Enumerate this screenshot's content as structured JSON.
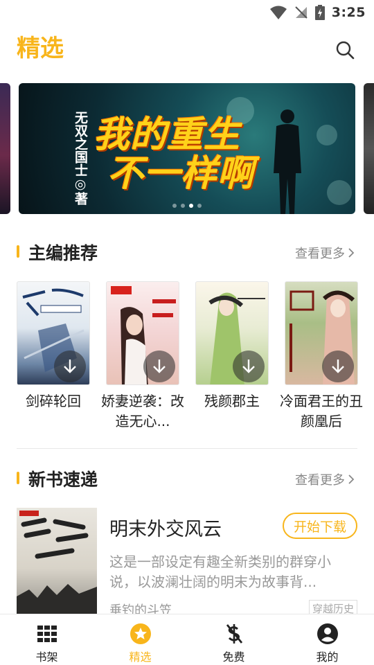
{
  "status_bar": {
    "time": "3:25"
  },
  "header": {
    "title": "精选"
  },
  "banner": {
    "title_line1": "我的重生",
    "title_line2": "不一样啊",
    "author_credit": "无双之国士◎著",
    "page_count": 4,
    "active_page": 3
  },
  "section_editor": {
    "title": "主编推荐",
    "more_label": "查看更多"
  },
  "editor_books": [
    {
      "name": "剑碎轮回"
    },
    {
      "name": "娇妻逆袭：改造无心..."
    },
    {
      "name": "残颜郡主"
    },
    {
      "name": "冷面君王的丑颜凰后"
    }
  ],
  "section_new": {
    "title": "新书速递",
    "more_label": "查看更多"
  },
  "new_book": {
    "title": "明末外交风云",
    "download_label": "开始下载",
    "description": "这是一部设定有趣全新类别的群穿小说，以波澜壮阔的明末为故事背...",
    "author": "垂钓的斗笠",
    "tag": "穿越历史"
  },
  "bottom_nav": [
    {
      "label": "书架",
      "icon": "grid-icon",
      "active": false
    },
    {
      "label": "精选",
      "icon": "star-circle-icon",
      "active": true
    },
    {
      "label": "免费",
      "icon": "no-dollar-icon",
      "active": false
    },
    {
      "label": "我的",
      "icon": "account-icon",
      "active": false
    }
  ],
  "colors": {
    "accent": "#f8b51b",
    "text": "#222222",
    "secondary_text": "#999999"
  }
}
